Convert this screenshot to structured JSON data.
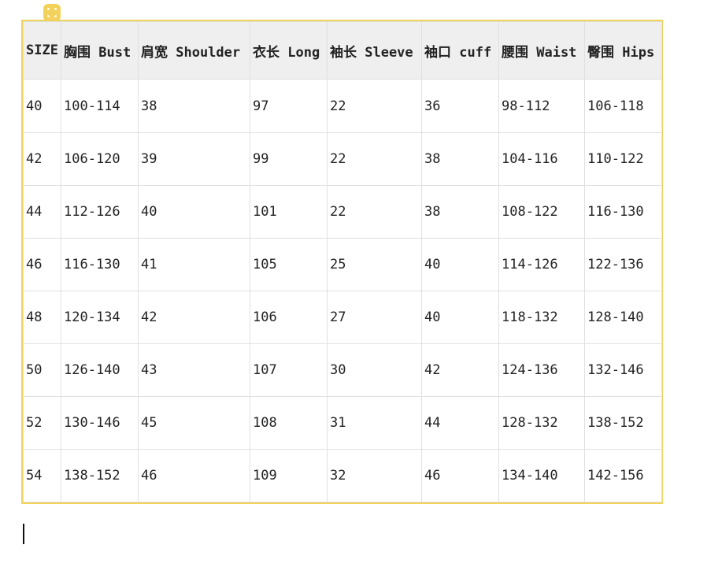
{
  "table": {
    "headers": [
      "SIZE",
      "胸围 Bust",
      "肩宽 Shoulder",
      "衣长 Long",
      "袖长 Sleeve",
      "袖口 cuff",
      "腰围 Waist",
      "臀围 Hips"
    ],
    "rows": [
      [
        "40",
        "100-114",
        "38",
        "97",
        "22",
        "36",
        "98-112",
        "106-118"
      ],
      [
        "42",
        "106-120",
        "39",
        "99",
        "22",
        "38",
        "104-116",
        "110-122"
      ],
      [
        "44",
        "112-126",
        "40",
        "101",
        "22",
        "38",
        "108-122",
        "116-130"
      ],
      [
        "46",
        "116-130",
        "41",
        "105",
        "25",
        "40",
        "114-126",
        "122-136"
      ],
      [
        "48",
        "120-134",
        "42",
        "106",
        "27",
        "40",
        "118-132",
        "128-140"
      ],
      [
        "50",
        "126-140",
        "43",
        "107",
        "30",
        "42",
        "124-136",
        "132-146"
      ],
      [
        "52",
        "130-146",
        "45",
        "108",
        "31",
        "44",
        "128-132",
        "138-152"
      ],
      [
        "54",
        "138-152",
        "46",
        "109",
        "32",
        "46",
        "134-140",
        "142-156"
      ]
    ]
  },
  "colors": {
    "selection_border": "#f1d35a",
    "header_background": "#efefef",
    "grid_line": "#e0e0e0"
  },
  "icons": {
    "table_handle": "table-select-icon"
  }
}
